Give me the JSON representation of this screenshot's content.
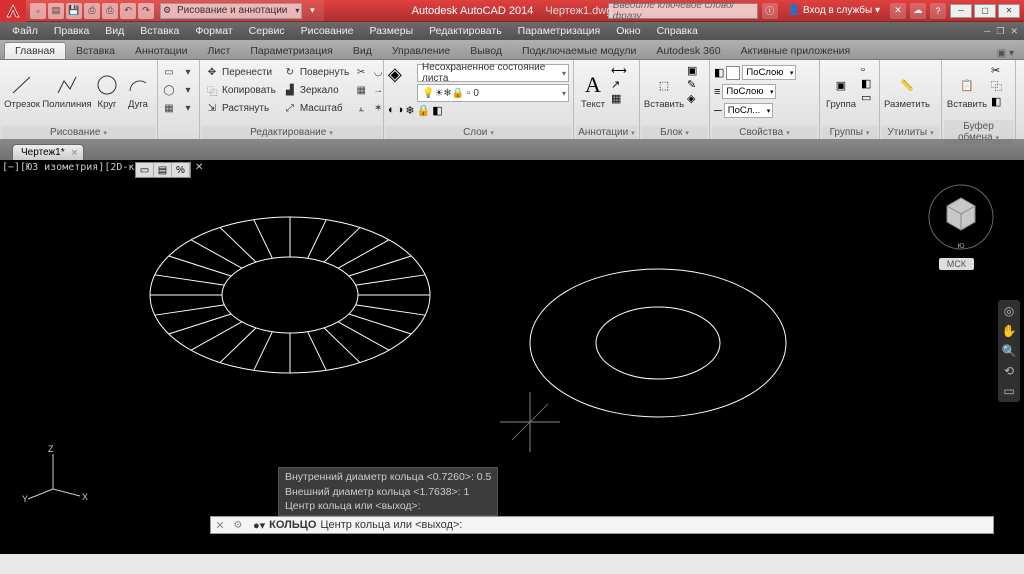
{
  "title": {
    "app": "Autodesk AutoCAD 2014",
    "file": "Чертеж1.dwg"
  },
  "workspace": "Рисование и аннотации",
  "search_placeholder": "Введите ключевое слово/фразу",
  "signin": "Вход в службы",
  "menu": [
    "Файл",
    "Правка",
    "Вид",
    "Вставка",
    "Формат",
    "Сервис",
    "Рисование",
    "Размеры",
    "Редактировать",
    "Параметризация",
    "Окно",
    "Справка"
  ],
  "ribbon_tabs": [
    "Главная",
    "Вставка",
    "Аннотации",
    "Лист",
    "Параметризация",
    "Вид",
    "Управление",
    "Вывод",
    "Подключаемые модули",
    "Autodesk 360",
    "Активные приложения"
  ],
  "panels": {
    "draw": {
      "title": "Рисование",
      "segment": "Отрезок",
      "polyline": "Полилиния",
      "circle": "Круг",
      "arc": "Дуга"
    },
    "modify": {
      "title": "Редактирование",
      "move": "Перенести",
      "copy": "Копировать",
      "stretch": "Растянуть",
      "rotate": "Повернуть",
      "mirror": "Зеркало",
      "scale": "Масштаб"
    },
    "layers": {
      "title": "Слои",
      "current": "Несохраненное состояние листа"
    },
    "annotation": {
      "title": "Аннотации",
      "text": "Текст"
    },
    "block": {
      "title": "Блок",
      "insert": "Вставить"
    },
    "properties": {
      "title": "Свойства",
      "bylayer": "ПоСлою",
      "bylayer2": "ПоСлою",
      "bylayer3": "ПоСл..."
    },
    "groups": {
      "title": "Группы",
      "group": "Группа"
    },
    "utilities": {
      "title": "Утилиты",
      "measure": "Разметить"
    },
    "clipboard": {
      "title": "Буфер обмена",
      "paste": "Вставить"
    }
  },
  "doc_tab": "Чертеж1*",
  "viewport_label": "[−][ЮЗ изометрия][2D-каркас]",
  "mcs": "МСК",
  "cmd_history": {
    "l1": "Внутренний диаметр кольца <0.7260>: 0.5",
    "l2": "Внешний диаметр кольца <1.7638>: 1",
    "l3": "Центр кольца или <выход>:"
  },
  "cmd": {
    "keyword": "КОЛЬЦО",
    "prompt": "Центр кольца или <выход>:"
  },
  "ucs": {
    "x": "X",
    "y": "Y",
    "z": "Z"
  }
}
